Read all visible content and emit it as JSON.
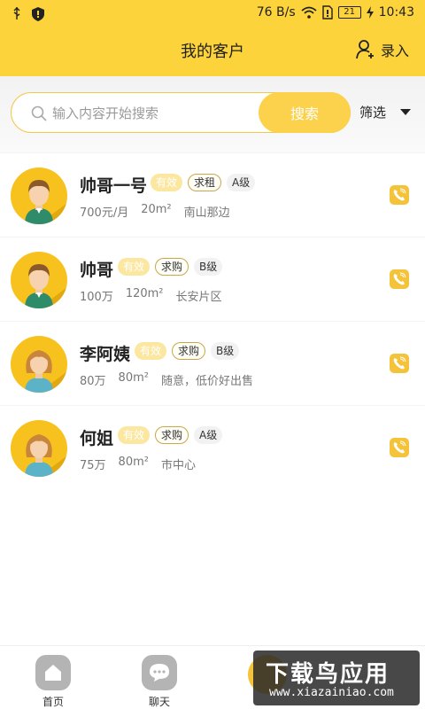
{
  "status_bar": {
    "net_speed": "76 B/s",
    "battery": "21",
    "time": "10:43"
  },
  "header": {
    "title": "我的客户",
    "entry_label": "录入"
  },
  "search": {
    "placeholder": "输入内容开始搜索",
    "button_label": "搜索",
    "filter_label": "筛选"
  },
  "customers": [
    {
      "name": "帅哥一号",
      "valid": "有效",
      "type": "求租",
      "level": "A级",
      "price": "700元/月",
      "area": "20m²",
      "location": "南山那边",
      "gender": "male"
    },
    {
      "name": "帅哥",
      "valid": "有效",
      "type": "求购",
      "level": "B级",
      "price": "100万",
      "area": "120m²",
      "location": "长安片区",
      "gender": "male"
    },
    {
      "name": "李阿姨",
      "valid": "有效",
      "type": "求购",
      "level": "B级",
      "price": "80万",
      "area": "80m²",
      "location": "随意，低价好出售",
      "gender": "female"
    },
    {
      "name": "何姐",
      "valid": "有效",
      "type": "求购",
      "level": "A级",
      "price": "75万",
      "area": "80m²",
      "location": "市中心",
      "gender": "female"
    }
  ],
  "bottom_nav": {
    "home_label": "首页",
    "chat_label": "聊天"
  },
  "watermark": {
    "main": "下载鸟应用",
    "sub": "www.xiazainiao.com"
  },
  "colors": {
    "accent": "#fcd33a",
    "phone": "#f5c33a",
    "avatar_bg": "#f7c21d"
  }
}
